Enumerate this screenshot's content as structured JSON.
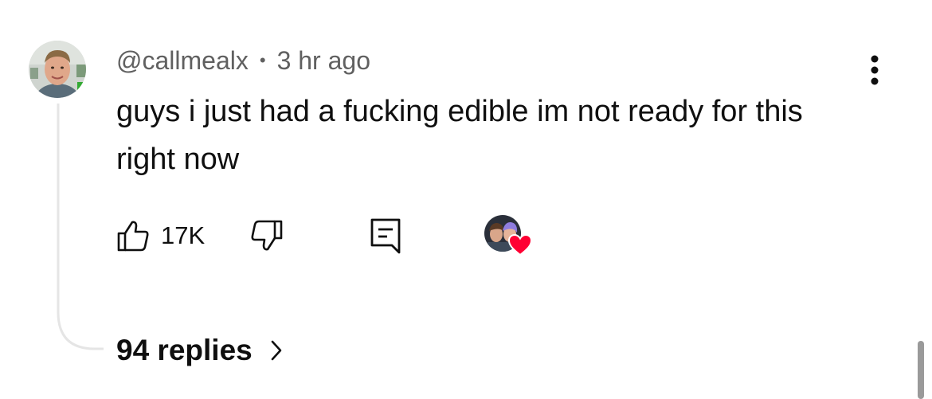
{
  "comment": {
    "author": "@callmealx",
    "separator": "•",
    "timestamp": "3 hr ago",
    "text": "guys i just had a fucking edible im not ready for this right now",
    "like_count": "17K",
    "replies_label": "94 replies"
  },
  "icons": {
    "avatar": "user-avatar",
    "more": "more-vertical-icon",
    "like": "thumbs-up-icon",
    "dislike": "thumbs-down-icon",
    "reply": "reply-comment-icon",
    "creator_heart": "creator-heart-icon",
    "chevron": "chevron-right-icon"
  },
  "colors": {
    "text": "#0f0f0f",
    "secondary_text": "#606060",
    "heart": "#ff0033",
    "thread_line": "#e5e5e5",
    "scrollbar": "#9a9a9a"
  }
}
